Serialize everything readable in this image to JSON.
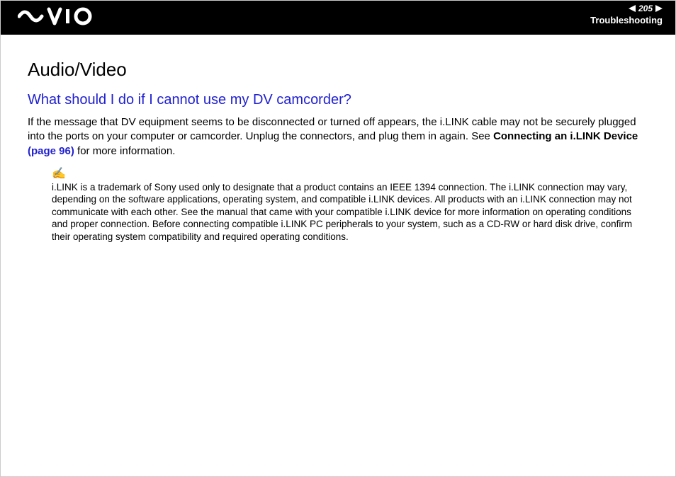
{
  "header": {
    "page_number": "205",
    "section_label": "Troubleshooting"
  },
  "content": {
    "section_title": "Audio/Video",
    "question": "What should I do if I cannot use my DV camcorder?",
    "para_part1": "If the message that DV equipment seems to be disconnected or turned off appears, the i.LINK cable may not be securely plugged into the ports on your computer or camcorder. Unplug the connectors, and plug them in again. See ",
    "para_bold": "Connecting an i.LINK Device ",
    "para_link": "(page 96)",
    "para_part2": " for more information.",
    "note_icon": "✍",
    "note_text": "i.LINK is a trademark of Sony used only to designate that a product contains an IEEE 1394 connection. The i.LINK connection may vary, depending on the software applications, operating system, and compatible i.LINK devices. All products with an i.LINK connection may not communicate with each other. See the manual that came with your compatible i.LINK device for more information on operating conditions and proper connection. Before connecting compatible i.LINK PC peripherals to your system, such as a CD-RW or hard disk drive, confirm their operating system compatibility and required operating conditions."
  }
}
